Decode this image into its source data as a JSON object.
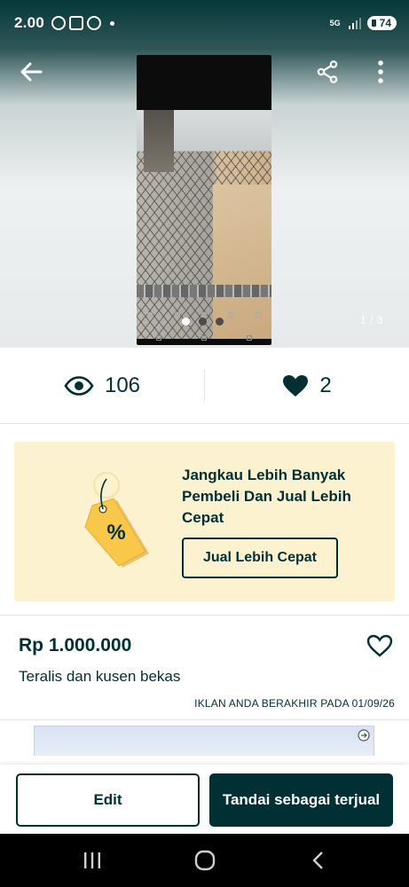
{
  "status_bar": {
    "time": "2.00",
    "sim_label": "5G",
    "battery": "74"
  },
  "gallery": {
    "page_counter": "1 / 3",
    "dot_count": 3,
    "active_index": 0
  },
  "stats": {
    "views": "106",
    "likes": "2"
  },
  "promo": {
    "text": "Jangkau Lebih Banyak Pembeli Dan Jual Lebih Cepat",
    "button_label": "Jual Lebih Cepat",
    "tag_symbol": "%"
  },
  "listing": {
    "price": "Rp 1.000.000",
    "title": "Teralis dan kusen bekas",
    "expiry": "IKLAN ANDA BERAKHIR PADA 01/09/26"
  },
  "actions": {
    "edit_label": "Edit",
    "mark_sold_label": "Tandai sebagai terjual"
  },
  "colors": {
    "primary": "#002f34",
    "promo_background": "#fdf2d0",
    "tag_yellow": "#f9c74a"
  },
  "icons": {
    "back": "arrow-left-icon",
    "share": "share-icon",
    "more": "more-vertical-icon",
    "views": "eye-icon",
    "likes": "heart-filled-icon",
    "favorite": "heart-outline-icon",
    "promo": "price-tag-icon"
  }
}
